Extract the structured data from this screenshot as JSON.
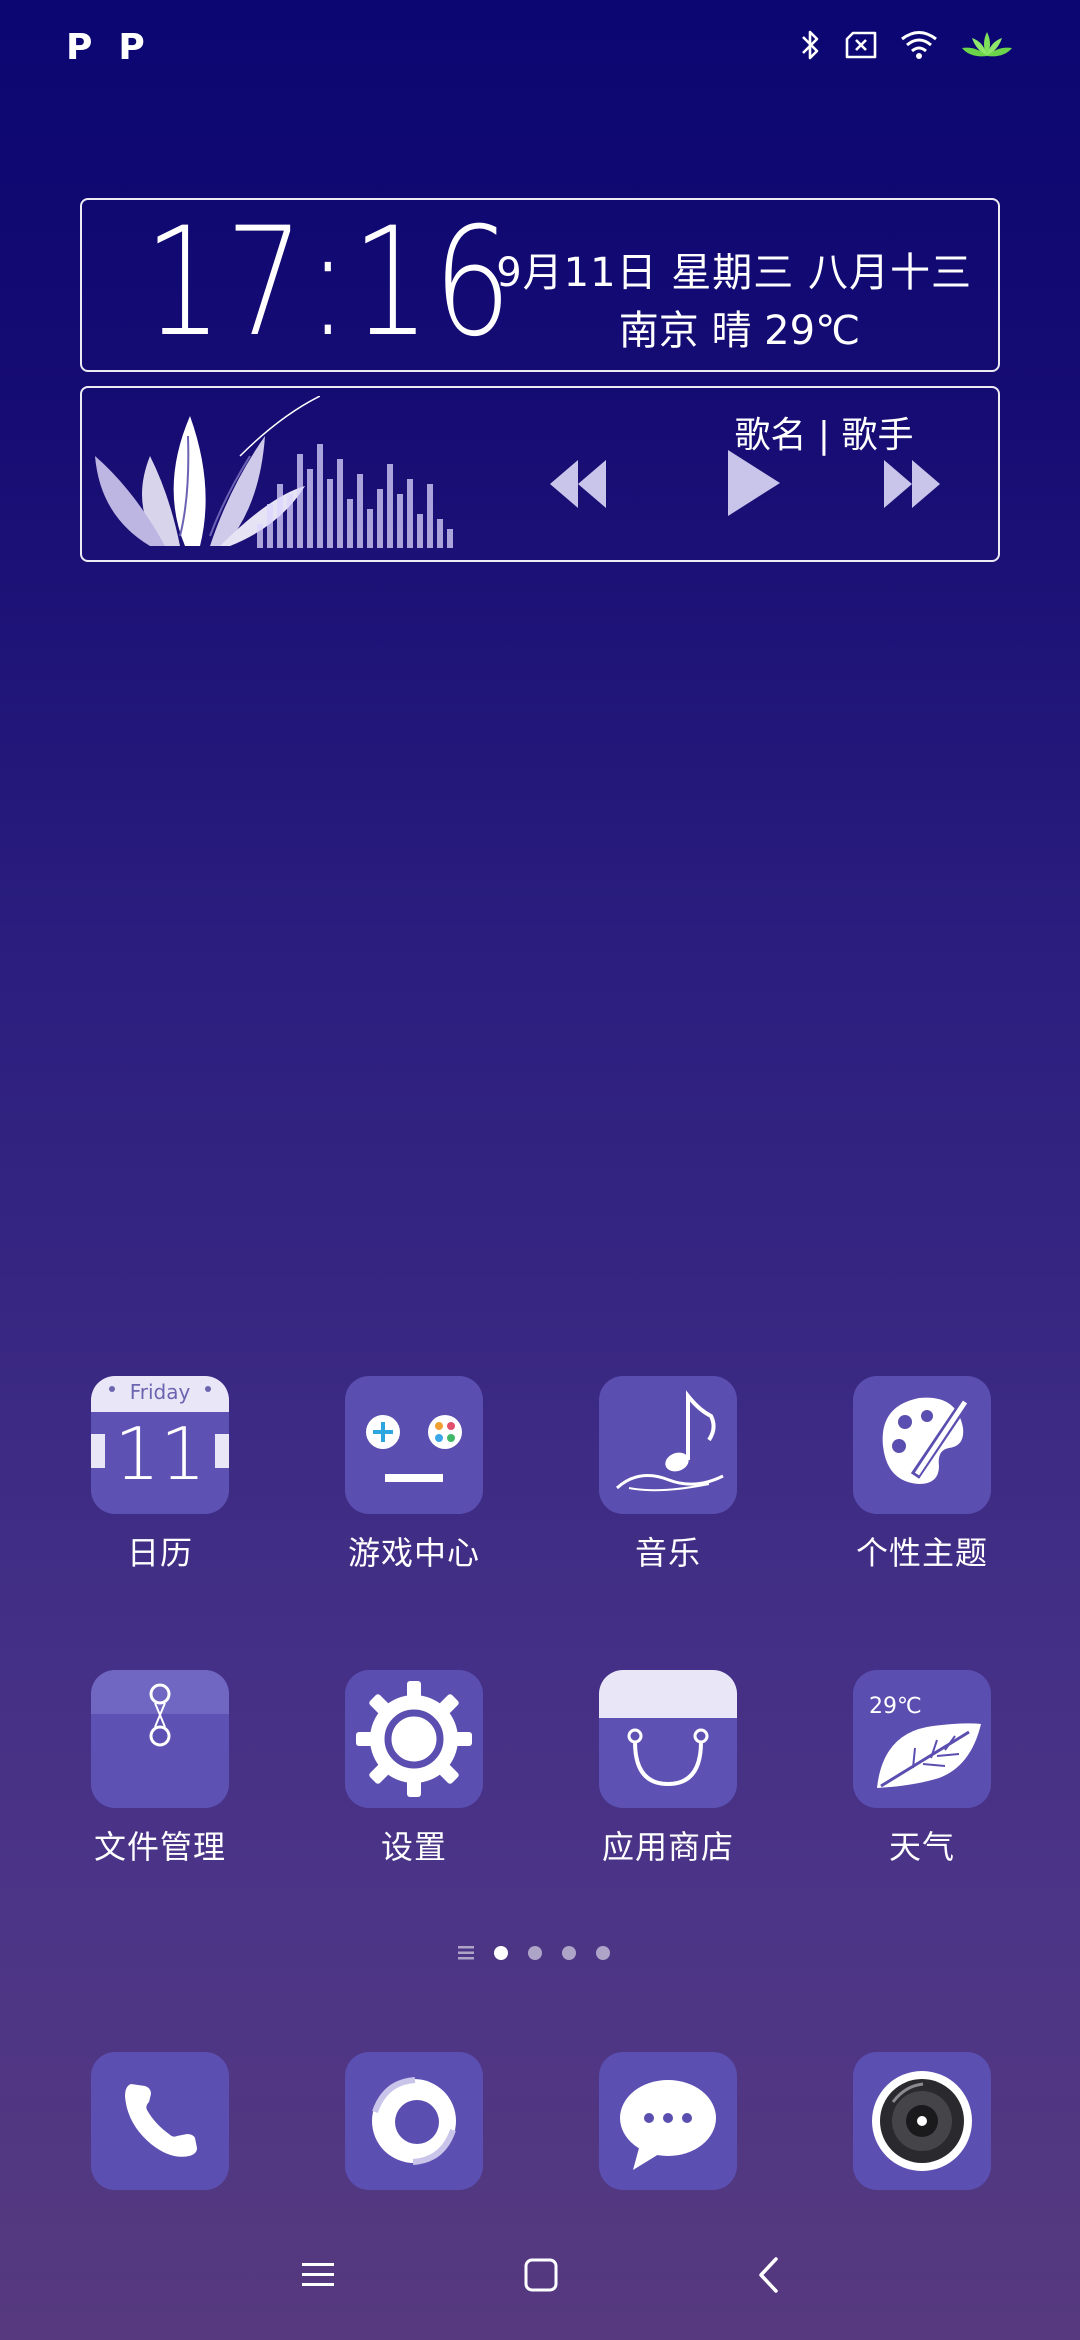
{
  "status_bar": {
    "left_icons": [
      "P",
      "P"
    ],
    "right_icons": [
      "bluetooth-icon",
      "sim-off-icon",
      "wifi-icon",
      "lotus-icon"
    ]
  },
  "clock_widget": {
    "time": "17:16",
    "date": "9月11日 星期三 八月十三",
    "weather": "南京 晴 29℃"
  },
  "music_widget": {
    "song": "歌名 | 歌手",
    "controls": [
      "previous-icon",
      "play-icon",
      "next-icon"
    ]
  },
  "apps": [
    {
      "label": "日历",
      "icon": "calendar-icon",
      "detail_top": "Friday",
      "detail_num": "11"
    },
    {
      "label": "游戏中心",
      "icon": "game-controller-icon"
    },
    {
      "label": "音乐",
      "icon": "music-note-icon"
    },
    {
      "label": "个性主题",
      "icon": "palette-icon"
    },
    {
      "label": "文件管理",
      "icon": "folder-icon"
    },
    {
      "label": "设置",
      "icon": "gear-icon"
    },
    {
      "label": "应用商店",
      "icon": "shopping-bag-icon"
    },
    {
      "label": "天气",
      "icon": "leaf-icon",
      "detail": "29℃"
    }
  ],
  "page_indicator": {
    "count": 4,
    "active": 0
  },
  "dock": [
    {
      "icon": "phone-icon"
    },
    {
      "icon": "browser-icon"
    },
    {
      "icon": "message-icon"
    },
    {
      "icon": "camera-icon"
    }
  ],
  "colors": {
    "tile": "#5a4fb0",
    "bg_top": "#0b0672",
    "bg_bottom": "#56397e"
  }
}
